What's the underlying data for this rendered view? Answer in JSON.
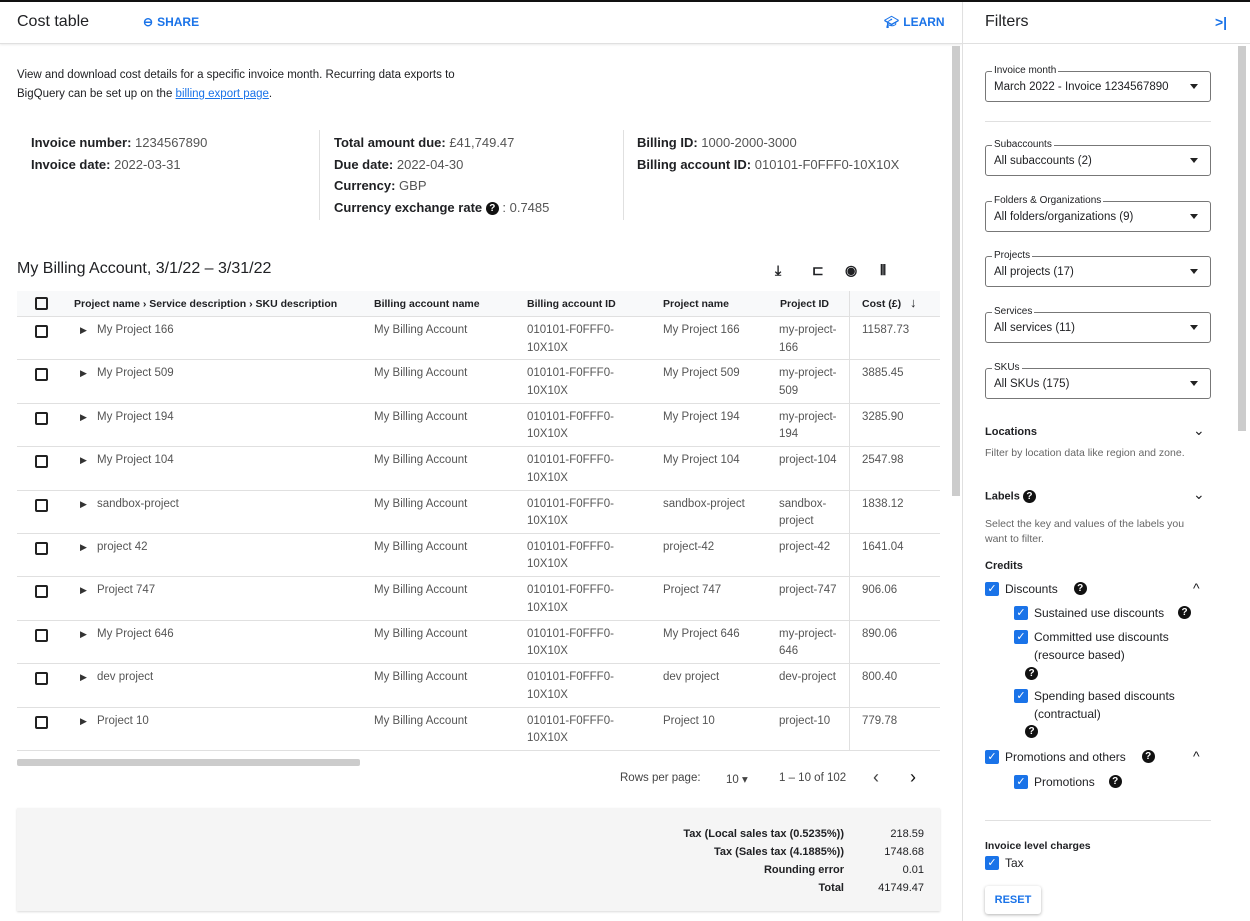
{
  "header": {
    "title": "Cost table",
    "share": "SHARE",
    "learn": "LEARN"
  },
  "intro": {
    "text": "View and download cost details for a specific invoice month. Recurring data exports to BigQuery can be set up on the ",
    "link": "billing export page",
    "end": "."
  },
  "summary": {
    "invoice_number_label": "Invoice number:",
    "invoice_number": "1234567890",
    "invoice_date_label": "Invoice date:",
    "invoice_date": "2022-03-31",
    "total_label": "Total amount due:",
    "total": "£41,749.47",
    "due_label": "Due date:",
    "due": "2022-04-30",
    "currency_label": "Currency:",
    "currency": "GBP",
    "rate_label": "Currency exchange rate",
    "rate": ": 0.7485",
    "billing_id_label": "Billing ID:",
    "billing_id": "1000-2000-3000",
    "account_id_label": "Billing account ID:",
    "account_id": "010101-F0FFF0-10X10X"
  },
  "table": {
    "title": "My Billing Account, 3/1/22 – 3/31/22",
    "toolbar_icons": [
      "download-icon",
      "hierarchy-icon",
      "visibility-icon",
      "columns-icon"
    ],
    "columns": [
      "Project name › Service description › SKU description",
      "Billing account name",
      "Billing account ID",
      "Project name",
      "Project ID",
      "Cost (£)"
    ],
    "rows": [
      {
        "name": "My Project 166",
        "account": "My Billing Account",
        "account_id": [
          "010101-F0FFF0-",
          "10X10X"
        ],
        "project": "My Project 166",
        "project_id": [
          "my-project-",
          "166"
        ],
        "cost": "11587.73"
      },
      {
        "name": "My Project 509",
        "account": "My Billing Account",
        "account_id": [
          "010101-F0FFF0-",
          "10X10X"
        ],
        "project": "My Project 509",
        "project_id": [
          "my-project-",
          "509"
        ],
        "cost": "3885.45"
      },
      {
        "name": "My Project 194",
        "account": "My Billing Account",
        "account_id": [
          "010101-F0FFF0-",
          "10X10X"
        ],
        "project": "My Project 194",
        "project_id": [
          "my-project-",
          "194"
        ],
        "cost": "3285.90"
      },
      {
        "name": "My Project 104",
        "account": "My Billing Account",
        "account_id": [
          "010101-F0FFF0-",
          "10X10X"
        ],
        "project": "My Project 104",
        "project_id": [
          "project-104",
          ""
        ],
        "cost": "2547.98"
      },
      {
        "name": "sandbox-project",
        "account": "My Billing Account",
        "account_id": [
          "010101-F0FFF0-",
          "10X10X"
        ],
        "project": "sandbox-project",
        "project_id": [
          "sandbox-",
          "project"
        ],
        "cost": "1838.12"
      },
      {
        "name": "project 42",
        "account": "My Billing Account",
        "account_id": [
          "010101-F0FFF0-",
          "10X10X"
        ],
        "project": "project-42",
        "project_id": [
          "project-42",
          ""
        ],
        "cost": "1641.04"
      },
      {
        "name": "Project 747",
        "account": "My Billing Account",
        "account_id": [
          "010101-F0FFF0-",
          "10X10X"
        ],
        "project": "Project 747",
        "project_id": [
          "project-747",
          ""
        ],
        "cost": "906.06"
      },
      {
        "name": "My Project 646",
        "account": "My Billing Account",
        "account_id": [
          "010101-F0FFF0-",
          "10X10X"
        ],
        "project": "My Project 646",
        "project_id": [
          "my-project-",
          "646"
        ],
        "cost": "890.06"
      },
      {
        "name": "dev project",
        "account": "My Billing Account",
        "account_id": [
          "010101-F0FFF0-",
          "10X10X"
        ],
        "project": "dev project",
        "project_id": [
          "dev-project",
          ""
        ],
        "cost": "800.40"
      },
      {
        "name": "Project 10",
        "account": "My Billing Account",
        "account_id": [
          "010101-F0FFF0-",
          "10X10X"
        ],
        "project": "Project 10",
        "project_id": [
          "project-10",
          ""
        ],
        "cost": "779.78"
      }
    ]
  },
  "pager": {
    "rows_label": "Rows per page:",
    "rows_value": "10",
    "range": "1 – 10 of 102"
  },
  "totals": [
    {
      "label": "Tax (Local sales tax (0.5235%))",
      "value": "218.59"
    },
    {
      "label": "Tax (Sales tax (4.1885%))",
      "value": "1748.68"
    },
    {
      "label": "Rounding error",
      "value": "0.01"
    },
    {
      "label": "Total",
      "value": "41749.47"
    }
  ],
  "filters": {
    "title": "Filters",
    "dropdowns": [
      {
        "label": "Invoice month",
        "value": "March 2022 - Invoice 1234567890"
      },
      {
        "label": "Subaccounts",
        "value": "All subaccounts (2)"
      },
      {
        "label": "Folders & Organizations",
        "value": "All folders/organizations (9)"
      },
      {
        "label": "Projects",
        "value": "All projects (17)"
      },
      {
        "label": "Services",
        "value": "All services (11)"
      },
      {
        "label": "SKUs",
        "value": "All SKUs (175)"
      }
    ],
    "locations": {
      "title": "Locations",
      "desc": "Filter by location data like region and zone."
    },
    "labels": {
      "title": "Labels",
      "desc": "Select the key and values of the labels you want to filter."
    },
    "credits": {
      "title": "Credits",
      "discounts": "Discounts",
      "sustained": "Sustained use discounts",
      "committed": "Committed use discounts (resource based)",
      "spending": "Spending based discounts (contractual)",
      "promotions_others": "Promotions and others",
      "promotions": "Promotions"
    },
    "invoice_charges": {
      "title": "Invoice level charges",
      "tax": "Tax"
    },
    "reset": "RESET"
  },
  "colors": {
    "accent": "#1a73e8"
  }
}
